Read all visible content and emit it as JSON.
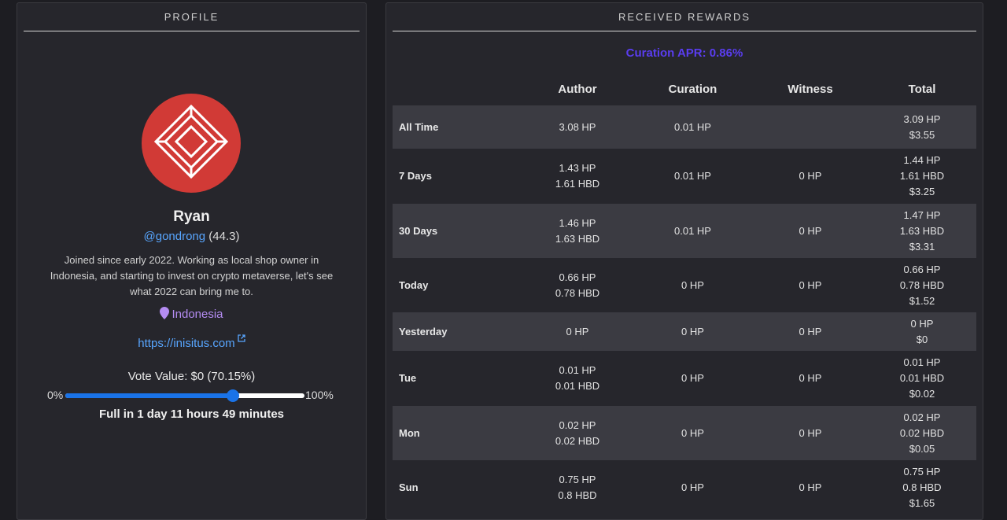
{
  "profile": {
    "panel_title": "PROFILE",
    "avatar_color": "#d13a36",
    "name": "Ryan",
    "handle": "@gondrong",
    "reputation": "(44.3)",
    "bio": "Joined since early 2022. Working as local shop owner in Indonesia, and starting to invest on crypto metaverse, let's see what 2022 can bring me to.",
    "location": "Indonesia",
    "website": "https://inisitus.com",
    "vote_value": "Vote Value: $0 (70.15%)",
    "slider_min": "0%",
    "slider_max": "100%",
    "slider_percent": 70.15,
    "full_in": "Full in 1 day 11 hours 49 minutes"
  },
  "rewards": {
    "panel_title": "RECEIVED REWARDS",
    "curation_apr": "Curation APR: 0.86%",
    "headers": {
      "label": "",
      "author": "Author",
      "curation": "Curation",
      "witness": "Witness",
      "total": "Total"
    },
    "rows": [
      {
        "label": "All Time",
        "author": [
          "3.08 HP"
        ],
        "curation": [
          "0.01 HP"
        ],
        "witness": [],
        "total": [
          "3.09 HP",
          "$3.55"
        ]
      },
      {
        "label": "7 Days",
        "author": [
          "1.43 HP",
          "1.61 HBD"
        ],
        "curation": [
          "0.01 HP"
        ],
        "witness": [
          "0 HP"
        ],
        "total": [
          "1.44 HP",
          "1.61 HBD",
          "$3.25"
        ]
      },
      {
        "label": "30 Days",
        "author": [
          "1.46 HP",
          "1.63 HBD"
        ],
        "curation": [
          "0.01 HP"
        ],
        "witness": [
          "0 HP"
        ],
        "total": [
          "1.47 HP",
          "1.63 HBD",
          "$3.31"
        ]
      },
      {
        "label": "Today",
        "author": [
          "0.66 HP",
          "0.78 HBD"
        ],
        "curation": [
          "0 HP"
        ],
        "witness": [
          "0 HP"
        ],
        "total": [
          "0.66 HP",
          "0.78 HBD",
          "$1.52"
        ]
      },
      {
        "label": "Yesterday",
        "author": [
          "0 HP"
        ],
        "curation": [
          "0 HP"
        ],
        "witness": [
          "0 HP"
        ],
        "total": [
          "0 HP",
          "$0"
        ]
      },
      {
        "label": "Tue",
        "author": [
          "0.01 HP",
          "0.01 HBD"
        ],
        "curation": [
          "0 HP"
        ],
        "witness": [
          "0 HP"
        ],
        "total": [
          "0.01 HP",
          "0.01 HBD",
          "$0.02"
        ]
      },
      {
        "label": "Mon",
        "author": [
          "0.02 HP",
          "0.02 HBD"
        ],
        "curation": [
          "0 HP"
        ],
        "witness": [
          "0 HP"
        ],
        "total": [
          "0.02 HP",
          "0.02 HBD",
          "$0.05"
        ]
      },
      {
        "label": "Sun",
        "author": [
          "0.75 HP",
          "0.8 HBD"
        ],
        "curation": [
          "0 HP"
        ],
        "witness": [
          "0 HP"
        ],
        "total": [
          "0.75 HP",
          "0.8 HBD",
          "$1.65"
        ]
      }
    ]
  }
}
